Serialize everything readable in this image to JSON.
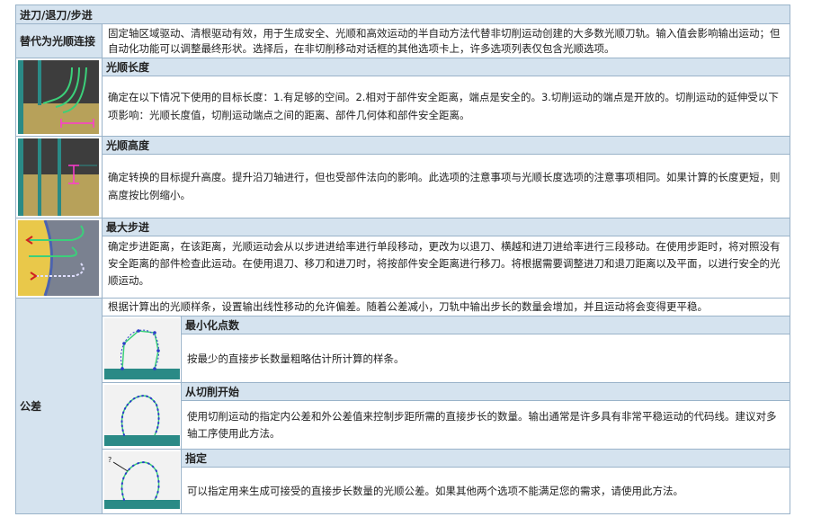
{
  "title": "进刀/退刀/步进",
  "rows": {
    "replace": {
      "label": "替代为光顺连接",
      "text": "固定轴区域驱动、清根驱动有效，用于生成安全、光顺和高效运动的半自动方法代替非切削运动创建的大多数光顺刀轨。输入值会影响输出运动；但自动化功能可以调整最终形状。选择后，在非切削移动对话框的其他选项卡上，许多选项列表仅包含光顺选项。"
    },
    "smooth_length": {
      "heading": "光顺长度",
      "text": "确定在以下情况下使用的目标长度：1.有足够的空间。2.相对于部件安全距离，端点是安全的。3.切削运动的端点是开放的。切削运动的延伸受以下项影响：光顺长度值，切削运动端点之间的距离、部件几何体和部件安全距离。"
    },
    "smooth_height": {
      "heading": "光顺高度",
      "text": "确定转换的目标提升高度。提升沿刀轴进行，但也受部件法向的影响。此选项的注意事项与光顺长度选项的注意事项相同。如果计算的长度更短，则高度按比例缩小。"
    },
    "max_stepover": {
      "heading": "最大步进",
      "text": "确定步进距离，在该距离，光顺运动会从以步进进给率进行单段移动，更改为以退刀、横越和进刀进给率进行三段移动。在使用步距时，将对照没有安全距离的部件检查此运动。在使用退刀、移刀和进刀时，将按部件安全距离进行移刀。将根据需要调整进刀和退刀距离以及平面，以进行安全的光顺运动。"
    },
    "tolerance": {
      "label": "公差",
      "text": "根据计算出的光顺样条，设置输出线性移动的允许偏差。随着公差减小，刀轨中输出步长的数量会增加，并且运动将会变得更平稳。",
      "options": [
        {
          "heading": "最小化点数",
          "text": "按最少的直接步长数量粗略估计所计算的样条。"
        },
        {
          "heading": "从切削开始",
          "text": "使用切削运动的指定内公差和外公差值来控制步距所需的直接步长的数量。输出通常是许多具有非常平稳运动的代码线。建议对多轴工序使用此方法。"
        },
        {
          "heading": "指定",
          "text": "可以指定用来生成可接受的直接步长数量的光顺公差。如果其他两个选项不能满足您的需求，请使用此方法。"
        }
      ]
    }
  },
  "colors": {
    "header_bg": "#d5e3ef",
    "border": "#9ab3c9",
    "part_tan": "#b7a15a",
    "teal": "#2a8a86",
    "toolpath_green": "#3bd07a"
  }
}
